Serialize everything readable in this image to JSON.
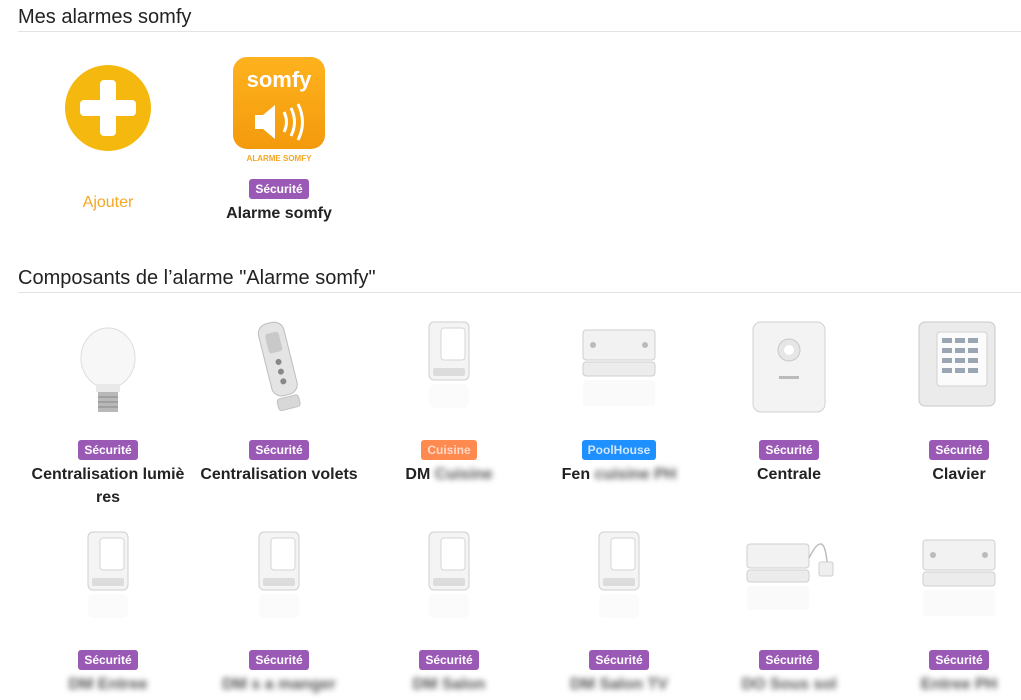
{
  "sections": {
    "alarms_title": "Mes alarmes somfy",
    "components_title": "Composants de l’alarme \"Alarme somfy\""
  },
  "add_tile": {
    "label": "Ajouter"
  },
  "alarm_tile": {
    "logo_text": "somfy",
    "logo_caption": "ALARME SOMFY",
    "badge": "Sécurité",
    "name": "Alarme somfy"
  },
  "components": [
    {
      "icon": "light-bulb-icon",
      "badge": "Sécurité",
      "badge_color": "#9b59b6",
      "name": "Centralisation lumière s",
      "name_line1": "Centralisation lumiè",
      "name_line2": "res"
    },
    {
      "icon": "remote-control-icon",
      "badge": "Sécurité",
      "badge_color": "#9b59b6",
      "name_line1": "Centralisation volets"
    },
    {
      "icon": "motion-detector-icon",
      "badge": "Cuisine",
      "badge_color": "#ff8a50",
      "name_prefix": "DM",
      "name_hidden": "Cuisine"
    },
    {
      "icon": "door-sensor-icon",
      "badge": "PoolHouse",
      "badge_color": "#1e90ff",
      "name_prefix": "Fen",
      "name_hidden": "cuisine PH"
    },
    {
      "icon": "alarm-central-icon",
      "badge": "Sécurité",
      "badge_color": "#9b59b6",
      "name_line1": "Centrale"
    },
    {
      "icon": "keypad-icon",
      "badge": "Sécurité",
      "badge_color": "#9b59b6",
      "name_line1": "Clavier"
    },
    {
      "icon": "motion-detector-icon",
      "badge": "Sécurité",
      "badge_color": "#9b59b6",
      "name_hidden": "DM Entree"
    },
    {
      "icon": "motion-detector-icon",
      "badge": "Sécurité",
      "badge_color": "#9b59b6",
      "name_hidden": "DM s a manger"
    },
    {
      "icon": "motion-detector-icon",
      "badge": "Sécurité",
      "badge_color": "#9b59b6",
      "name_hidden": "DM Salon"
    },
    {
      "icon": "motion-detector-icon",
      "badge": "Sécurité",
      "badge_color": "#9b59b6",
      "name_hidden": "DM Salon TV"
    },
    {
      "icon": "door-sensor-wired-icon",
      "badge": "Sécurité",
      "badge_color": "#9b59b6",
      "name_hidden": "DO Sous sol"
    },
    {
      "icon": "door-sensor-icon",
      "badge": "Sécurité",
      "badge_color": "#9b59b6",
      "name_hidden": "Entree PH"
    }
  ],
  "colors": {
    "accent": "#f5a623",
    "badge_purple": "#9b59b6",
    "badge_orange": "#ff8a50",
    "badge_blue": "#1e90ff"
  }
}
